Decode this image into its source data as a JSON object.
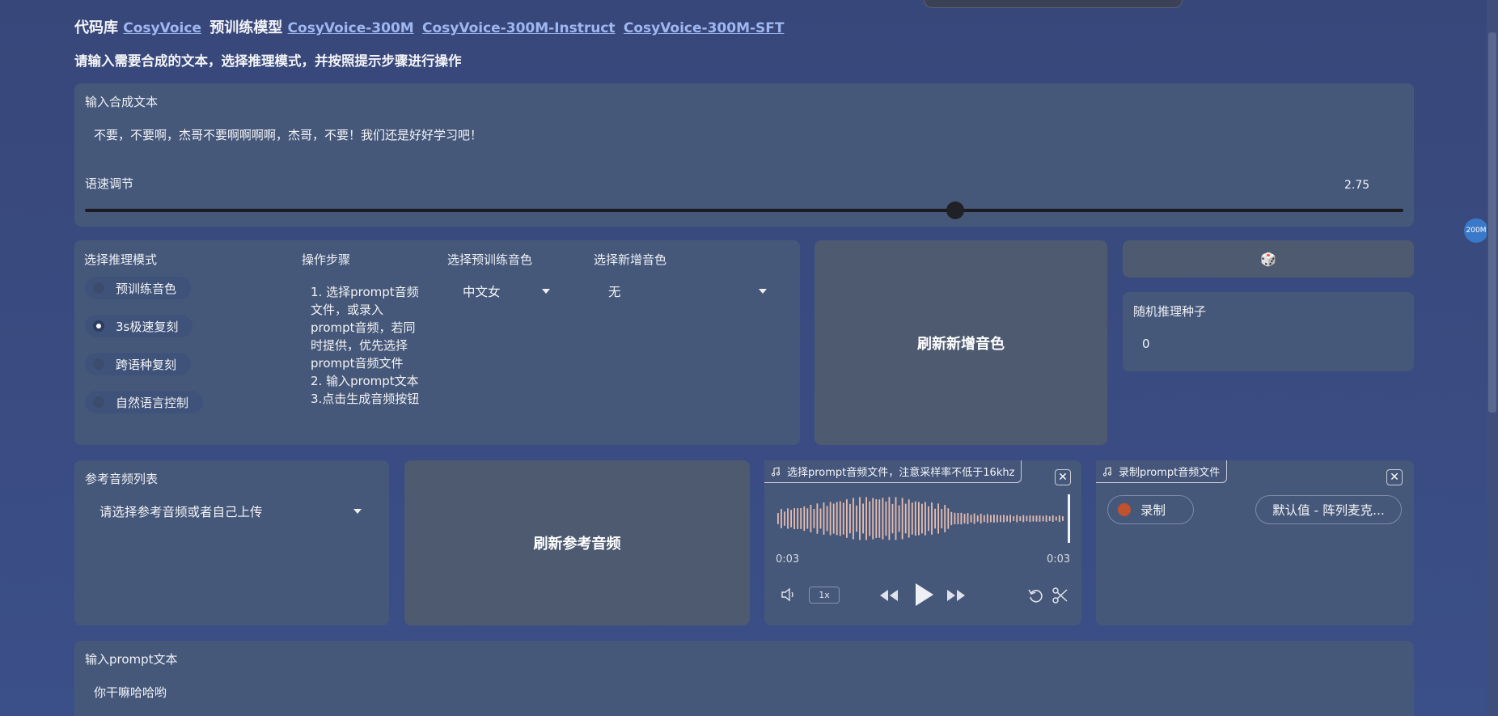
{
  "header": {
    "codebase_label": "代码库",
    "codebase_link": "CosyVoice",
    "pretrained_label": "预训练模型",
    "model_links": [
      "CosyVoice-300M",
      "CosyVoice-300M-Instruct",
      "CosyVoice-300M-SFT"
    ],
    "subtitle": "请输入需要合成的文本，选择推理模式，并按照提示步骤进行操作"
  },
  "synthesis": {
    "label": "输入合成文本",
    "value": "不要，不要啊，杰哥不要啊啊啊啊，杰哥，不要！我们还是好好学习吧！"
  },
  "speed": {
    "label": "语速调节",
    "value": "2.75",
    "fraction": 0.66
  },
  "inference_mode": {
    "label": "选择推理模式",
    "options": [
      "预训练音色",
      "3s极速复刻",
      "跨语种复刻",
      "自然语言控制"
    ],
    "selected": "3s极速复刻"
  },
  "steps": {
    "label": "操作步骤",
    "text": "1. 选择prompt音频文件，或录入prompt音频，若同时提供，优先选择prompt音频文件\n2. 输入prompt文本\n3.点击生成音频按钮"
  },
  "pretrained_voice": {
    "label": "选择预训练音色",
    "value": "中文女"
  },
  "new_voice": {
    "label": "选择新增音色",
    "value": "无"
  },
  "refresh_voice_button": "刷新新增音色",
  "seed": {
    "dice_icon": "🎲",
    "label": "随机推理种子",
    "value": "0"
  },
  "reference_audio": {
    "label": "参考音频列表",
    "value": "请选择参考音频或者自己上传"
  },
  "refresh_reference_button": "刷新参考音频",
  "prompt_audio": {
    "tag": "选择prompt音频文件，注意采样率不低于16khz",
    "time_current": "0:03",
    "time_total": "0:03",
    "speed": "1x"
  },
  "record": {
    "tag": "录制prompt音频文件",
    "record_label": "录制",
    "mic_value": "默认值 - 阵列麦克..."
  },
  "prompt_text": {
    "label": "输入prompt文本",
    "value": "你干嘛哈哈哟"
  },
  "badge": "200M",
  "colors": {
    "accent_link": "#9fb7f0",
    "record_dot": "#c0522e",
    "waveform": "#e6bcb0"
  },
  "icons": {
    "music": "music-note-icon",
    "close": "close-icon",
    "volume": "volume-icon",
    "rewind": "rewind-icon",
    "play": "play-icon",
    "forward": "forward-icon",
    "undo": "undo-icon",
    "trim": "scissors-icon"
  }
}
